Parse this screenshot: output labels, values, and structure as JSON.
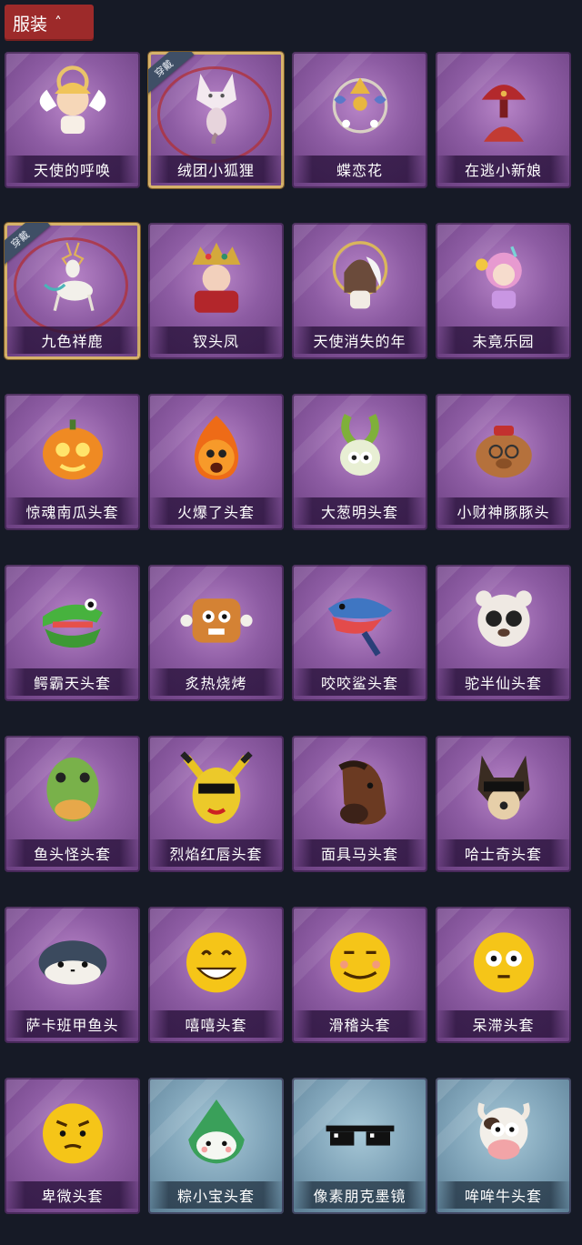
{
  "header": {
    "tab_label": "服装"
  },
  "equipped_badge": "穿戴",
  "items": [
    {
      "label": "天使的呼唤",
      "variant": "purple",
      "equipped": false,
      "icon": "angel-doll-icon"
    },
    {
      "label": "绒团小狐狸",
      "variant": "purple",
      "equipped": true,
      "icon": "fox-pendant-icon"
    },
    {
      "label": "蝶恋花",
      "variant": "purple",
      "equipped": false,
      "icon": "flower-wreath-icon"
    },
    {
      "label": "在逃小新娘",
      "variant": "purple",
      "equipped": false,
      "icon": "bride-lamp-icon"
    },
    {
      "label": "九色祥鹿",
      "variant": "purple",
      "equipped": true,
      "icon": "deer-pendant-icon"
    },
    {
      "label": "钗头凤",
      "variant": "purple",
      "equipped": false,
      "icon": "phoenix-crown-icon"
    },
    {
      "label": "天使消失的年",
      "variant": "purple",
      "equipped": false,
      "icon": "angel-girl-icon"
    },
    {
      "label": "未竟乐园",
      "variant": "purple",
      "equipped": false,
      "icon": "pink-girl-icon"
    },
    {
      "label": "惊魂南瓜头套",
      "variant": "purple",
      "equipped": false,
      "icon": "pumpkin-icon"
    },
    {
      "label": "火爆了头套",
      "variant": "purple",
      "equipped": false,
      "icon": "fire-head-icon"
    },
    {
      "label": "大葱明头套",
      "variant": "purple",
      "equipped": false,
      "icon": "scallion-head-icon"
    },
    {
      "label": "小财神豚豚头",
      "variant": "purple",
      "equipped": false,
      "icon": "capybara-head-icon"
    },
    {
      "label": "鳄霸天头套",
      "variant": "purple",
      "equipped": false,
      "icon": "crocodile-head-icon"
    },
    {
      "label": "炙热烧烤",
      "variant": "purple",
      "equipped": false,
      "icon": "bbq-meat-icon"
    },
    {
      "label": "咬咬鲨头套",
      "variant": "purple",
      "equipped": false,
      "icon": "shark-head-icon"
    },
    {
      "label": "驼半仙头套",
      "variant": "purple",
      "equipped": false,
      "icon": "bear-head-icon"
    },
    {
      "label": "鱼头怪头套",
      "variant": "purple",
      "equipped": false,
      "icon": "fish-head-icon"
    },
    {
      "label": "烈焰红唇头套",
      "variant": "purple",
      "equipped": false,
      "icon": "yellow-mouse-head-icon"
    },
    {
      "label": "面具马头套",
      "variant": "purple",
      "equipped": false,
      "icon": "horse-head-icon"
    },
    {
      "label": "哈士奇头套",
      "variant": "purple",
      "equipped": false,
      "icon": "husky-head-icon"
    },
    {
      "label": "萨卡班甲鱼头",
      "variant": "purple",
      "equipped": false,
      "icon": "sacabambaspis-icon"
    },
    {
      "label": "嘻嘻头套",
      "variant": "purple",
      "equipped": false,
      "icon": "grin-emoji-icon"
    },
    {
      "label": "滑稽头套",
      "variant": "purple",
      "equipped": false,
      "icon": "smirk-emoji-icon"
    },
    {
      "label": "呆滞头套",
      "variant": "purple",
      "equipped": false,
      "icon": "stare-emoji-icon"
    },
    {
      "label": "卑微头套",
      "variant": "purple",
      "equipped": false,
      "icon": "humble-emoji-icon"
    },
    {
      "label": "粽小宝头套",
      "variant": "blue",
      "equipped": false,
      "icon": "zongzi-head-icon"
    },
    {
      "label": "像素朋克墨镜",
      "variant": "blue",
      "equipped": false,
      "icon": "pixel-sunglasses-icon"
    },
    {
      "label": "哞哞牛头套",
      "variant": "blue",
      "equipped": false,
      "icon": "cow-head-icon"
    }
  ],
  "colors": {
    "header_bg": "#9d2a2a",
    "page_bg": "#161a26",
    "card_purple": "#8d5ca3",
    "card_blue": "#7fa3b8",
    "equipped_border": "#d6b26a"
  }
}
